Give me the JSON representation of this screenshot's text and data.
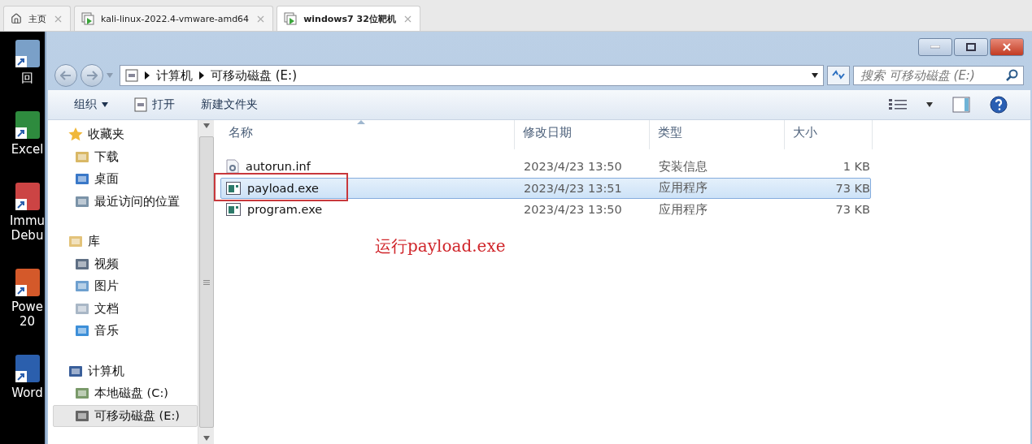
{
  "tabs": [
    {
      "label": "主页",
      "kind": "home",
      "selected": false
    },
    {
      "label": "kali-linux-2022.4-vmware-amd64",
      "kind": "vm",
      "selected": false
    },
    {
      "label": "windows7 32位靶机",
      "kind": "vm",
      "selected": true
    }
  ],
  "desktop_icons": [
    {
      "label": "回"
    },
    {
      "label": "Excel"
    },
    {
      "label": "Immu\nDebu"
    },
    {
      "label": "Powe\n20"
    },
    {
      "label": "Word"
    }
  ],
  "address": {
    "breadcrumbs": [
      "计算机",
      "可移动磁盘 (E:)"
    ]
  },
  "search": {
    "placeholder": "搜索 可移动磁盘 (E:)"
  },
  "toolbar": {
    "organize": "组织",
    "open": "打开",
    "new_folder": "新建文件夹"
  },
  "sidebar": [
    {
      "label": "收藏夹",
      "selected": false,
      "children": [
        {
          "label": "下载",
          "selected": false
        },
        {
          "label": "桌面",
          "selected": false
        },
        {
          "label": "最近访问的位置",
          "selected": false
        }
      ]
    },
    {
      "label": "库",
      "selected": false,
      "children": [
        {
          "label": "视频",
          "selected": false
        },
        {
          "label": "图片",
          "selected": false
        },
        {
          "label": "文档",
          "selected": false
        },
        {
          "label": "音乐",
          "selected": false
        }
      ]
    },
    {
      "label": "计算机",
      "selected": false,
      "children": [
        {
          "label": "本地磁盘 (C:)",
          "selected": false
        },
        {
          "label": "可移动磁盘 (E:)",
          "selected": true
        }
      ]
    }
  ],
  "table": {
    "columns": [
      "名称",
      "修改日期",
      "类型",
      "大小"
    ],
    "rows": [
      {
        "kind": "inf",
        "name": "autorun.inf",
        "modified": "2023/4/23 13:50",
        "type": "安装信息",
        "size": "1 KB",
        "selected": false
      },
      {
        "kind": "exe",
        "name": "payload.exe",
        "modified": "2023/4/23 13:51",
        "type": "应用程序",
        "size": "73 KB",
        "selected": true
      },
      {
        "kind": "exe",
        "name": "program.exe",
        "modified": "2023/4/23 13:50",
        "type": "应用程序",
        "size": "73 KB",
        "selected": false
      }
    ]
  },
  "annotation": "运行payload.exe"
}
